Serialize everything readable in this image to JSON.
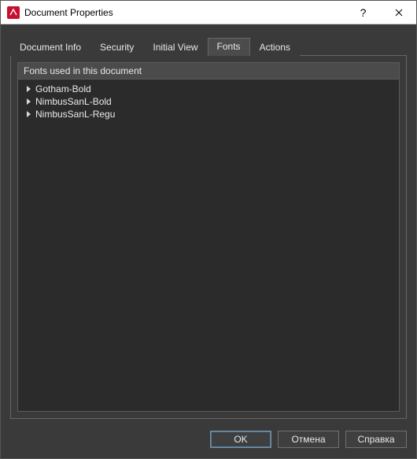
{
  "window": {
    "title": "Document Properties"
  },
  "tabs": {
    "items": [
      {
        "label": "Document Info"
      },
      {
        "label": "Security"
      },
      {
        "label": "Initial View"
      },
      {
        "label": "Fonts"
      },
      {
        "label": "Actions"
      }
    ],
    "active_index": 3
  },
  "panel": {
    "header": "Fonts used in this document",
    "fonts": [
      {
        "name": "Gotham-Bold"
      },
      {
        "name": "NimbusSanL-Bold"
      },
      {
        "name": "NimbusSanL-Regu"
      }
    ]
  },
  "buttons": {
    "ok": "OK",
    "cancel": "Отмена",
    "help": "Справка"
  }
}
